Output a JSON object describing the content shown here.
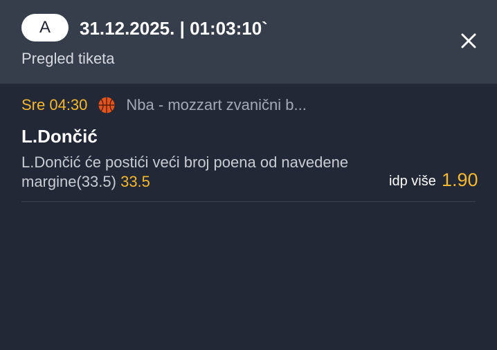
{
  "header": {
    "badge": "A",
    "datetime": "31.12.2025. | 01:03:10`",
    "subtitle": "Pregled tiketa"
  },
  "bet": {
    "event_time": "Sre 04:30",
    "sport_icon": "basketball-icon",
    "league": "Nba - mozzart zvanični b...",
    "player": "L.Dončić",
    "description_line1": "L.Dončić će postići veći broj poena od navedene",
    "description_line2": "margine(33.5)",
    "line_value": "33.5",
    "pick": "idp više",
    "odds": "1.90"
  },
  "colors": {
    "header_bg": "#363d4b",
    "body_bg": "#222836",
    "accent": "#f5b82e"
  }
}
